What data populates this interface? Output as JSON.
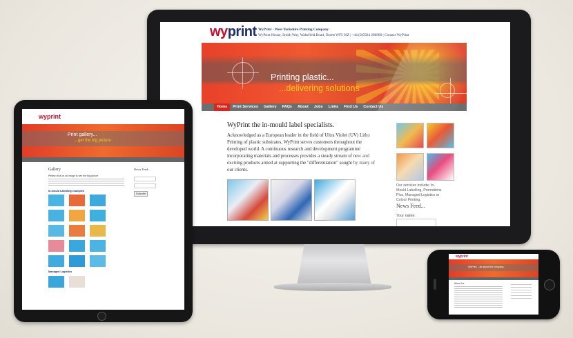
{
  "imac": {
    "logo_part1": "wy",
    "logo_part2": "print",
    "header_line1": "WyPrint - West Yorkshire Printing Company",
    "header_line2": "WyPrint House, Smith Way, Wakefield Road, Ossett WF5 9JZ | +44 (0)5924 280900 | Contact WyPrint",
    "banner_line1": "Printing plastic...",
    "banner_line2": "...delivering solutions",
    "nav": [
      "Home",
      "Print Services",
      "Gallery",
      "FAQs",
      "About",
      "Jobs",
      "Links",
      "Find Us",
      "Contact Us"
    ],
    "heading": "WyPrint the in-mould label specialists.",
    "paragraph": "Acknowledged as a European leader in the field of Ultra Violet (UV) Litho Printing of plastic substrates, WyPrint serves customers throughout the developed world. A continuous research and development programme incorporating materials and processes provides a steady stream of new and exciting products aimed at supporting the \"differentiation\" sought by many of our clients.",
    "services_text": "Our services include: In-Mould Labelling, Promotions Plus, Managed Logistics or Colour Printing.",
    "news_heading": "News Feed...",
    "your_name_label": "Your name:"
  },
  "ipad": {
    "logo": "wyprint",
    "banner_line1": "Print gallery...",
    "banner_line2": "...get the big picture",
    "gallery_heading": "Gallery",
    "gallery_sub": "Please click on an image to see the big picture",
    "section1": "In-mould Labelling examples",
    "section2": "Managed Logistics",
    "news_heading": "News Feed...",
    "subscribe": "Subscribe"
  },
  "iphone": {
    "logo": "wyprint",
    "banner": "WyPrint ...all about the company",
    "heading": "About Us"
  },
  "colors": {
    "brand_red": "#c8102e",
    "brand_navy": "#1f2f6b",
    "nav_active": "#d9261c",
    "banner_yellow": "#f7d016"
  }
}
